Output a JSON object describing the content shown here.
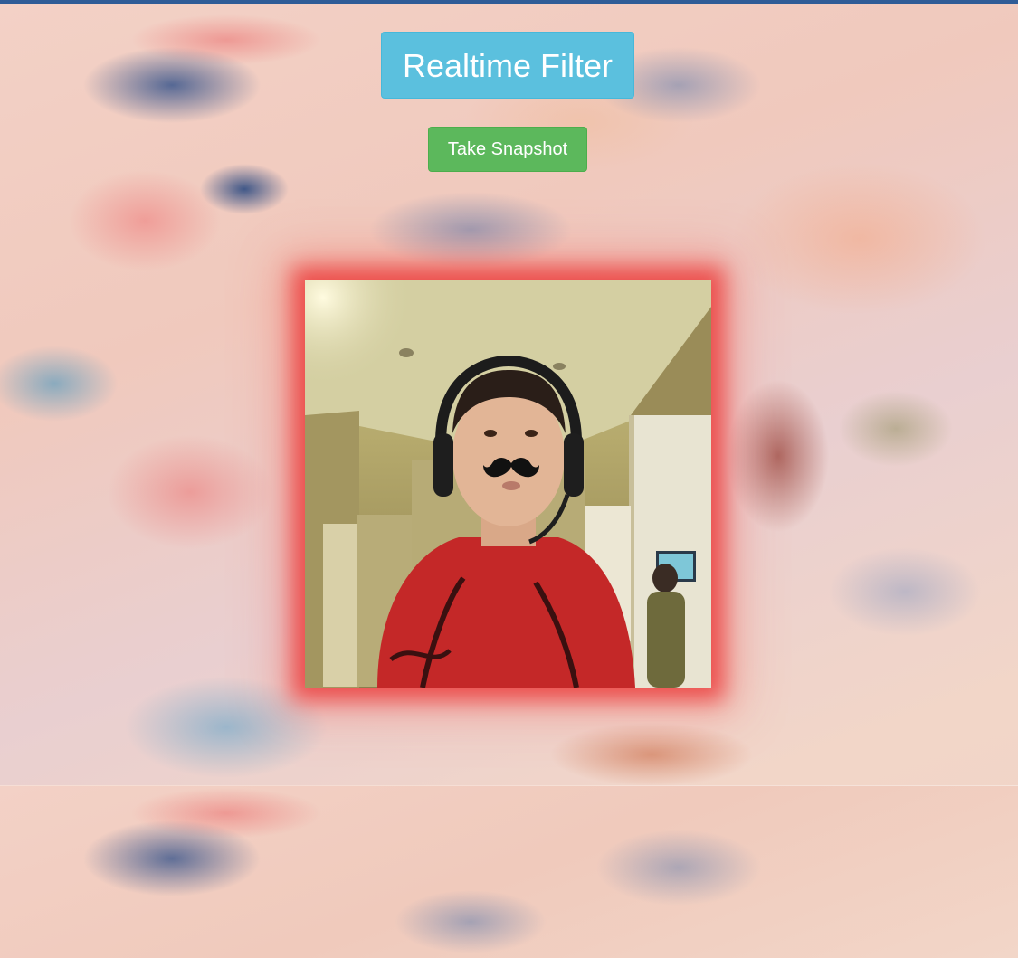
{
  "header": {
    "title": "Realtime Filter"
  },
  "controls": {
    "snapshot_label": "Take Snapshot"
  },
  "video": {
    "filter": "mustache-icon",
    "glow_color": "#eb3232"
  },
  "colors": {
    "title_bg": "#5bc0de",
    "snapshot_bg": "#5cb85c"
  }
}
